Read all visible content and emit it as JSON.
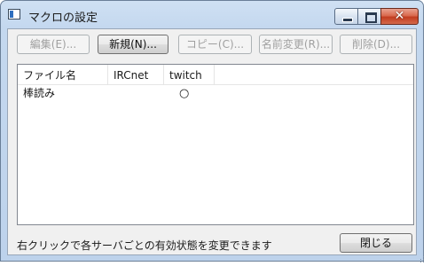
{
  "window": {
    "title": "マクロの設定",
    "close_glyph": "✕"
  },
  "toolbar": {
    "edit": "編集(E)...",
    "new": "新規(N)...",
    "copy": "コピー(C)...",
    "rename": "名前変更(R)...",
    "delete": "削除(D)..."
  },
  "list": {
    "columns": [
      "ファイル名",
      "IRCnet",
      "twitch"
    ],
    "rows": [
      {
        "name": "棒読み",
        "ircnet": "",
        "twitch": "○"
      }
    ]
  },
  "footer": {
    "hint": "右クリックで各サーバごとの有効状態を変更できます",
    "close": "閉じる"
  }
}
